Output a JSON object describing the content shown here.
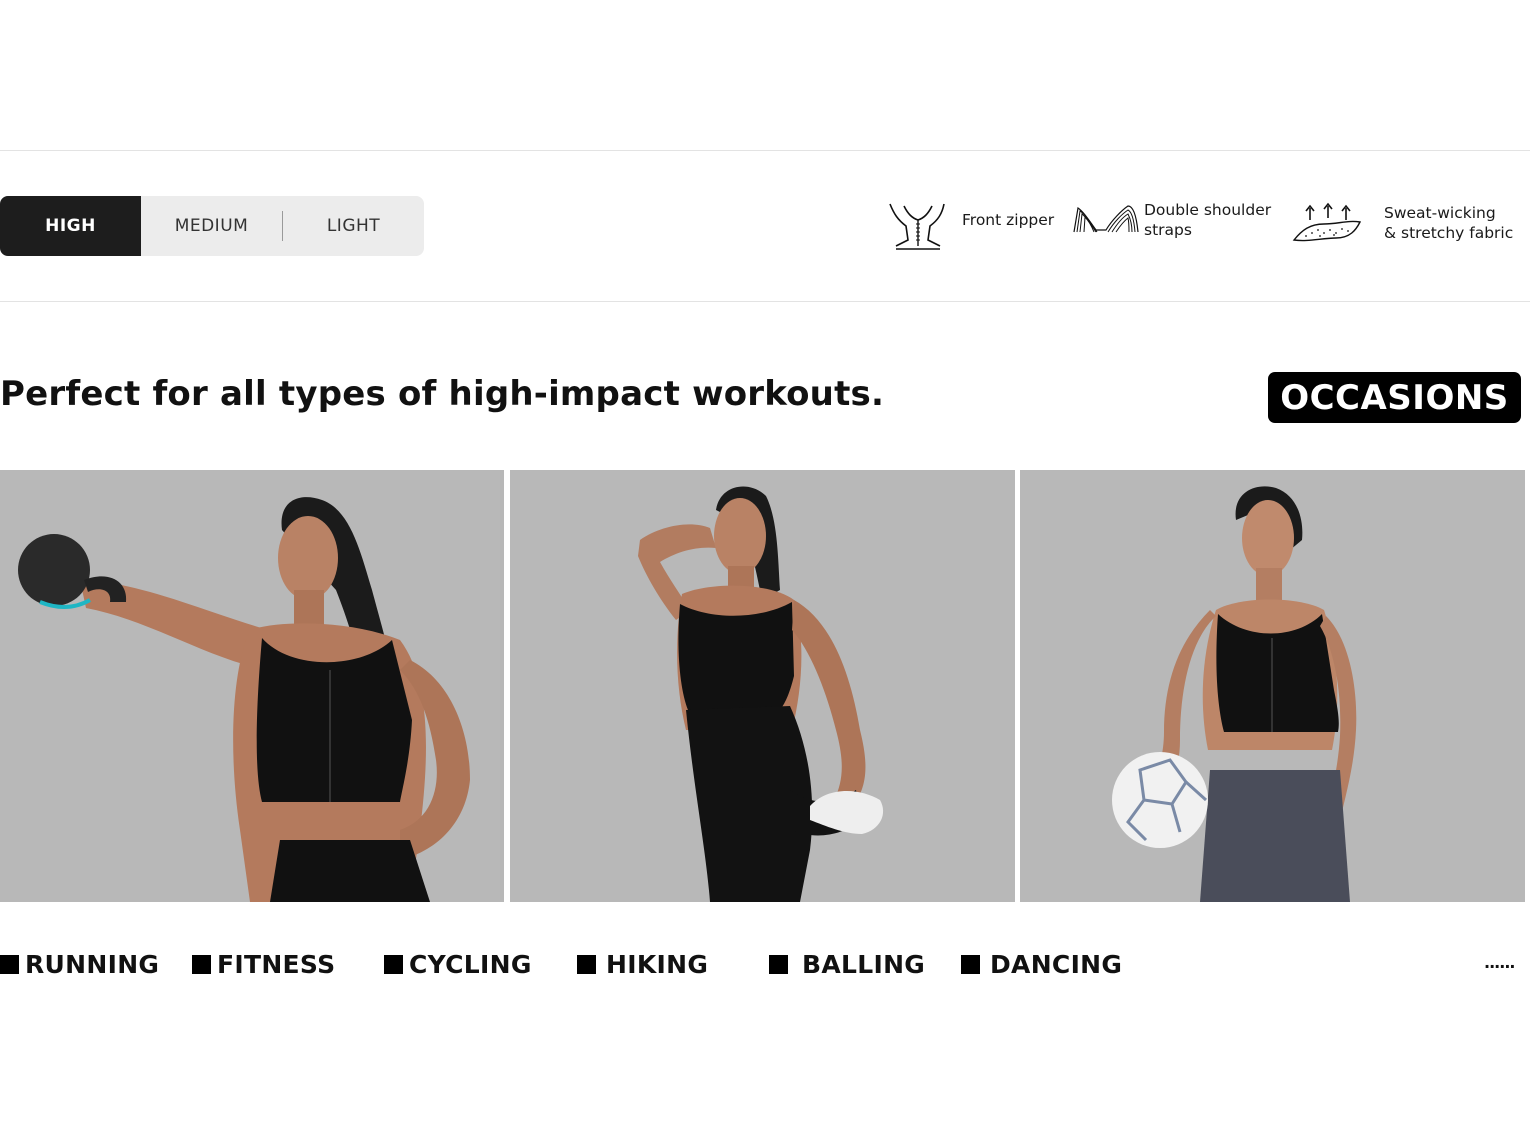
{
  "support_levels": {
    "options": [
      "HIGH",
      "MEDIUM",
      "LIGHT"
    ],
    "selected": "HIGH"
  },
  "features": [
    {
      "icon": "zipper-icon",
      "line1": "Front zipper",
      "line2": ""
    },
    {
      "icon": "shoulder-straps-icon",
      "line1": "Double shoulder",
      "line2": "straps"
    },
    {
      "icon": "sweat-wicking-icon",
      "line1": "Sweat-wicking",
      "line2": "& stretchy fabric"
    }
  ],
  "headline": "Perfect for all types of high-impact workouts.",
  "occasions_badge": "OCCASIONS",
  "photos": [
    {
      "icon": "kettlebell-workout-photo"
    },
    {
      "icon": "stretching-photo"
    },
    {
      "icon": "soccer-ball-photo"
    }
  ],
  "activities": [
    "RUNNING",
    "FITNESS",
    "CYCLING",
    "HIKING",
    "BALLING",
    "DANCING"
  ],
  "more_indicator": "......",
  "colors": {
    "active_segment": "#1d1d1d",
    "segment_bg": "#ececec",
    "photo_bg": "#b8b8b8",
    "badge_bg": "#000000",
    "accent_teal": "#1fb6c4",
    "legging_gray": "#4a4d5a"
  }
}
